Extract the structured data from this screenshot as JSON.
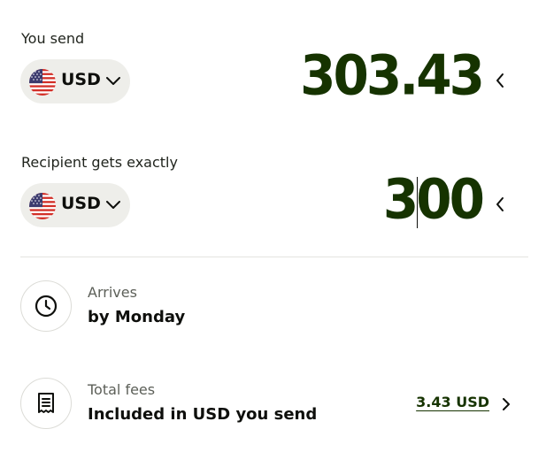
{
  "send": {
    "label": "You send",
    "currency": "USD",
    "currency_flag_icon": "us-flag-icon",
    "amount": "303.43"
  },
  "receive": {
    "label": "Recipient gets exactly",
    "currency": "USD",
    "currency_flag_icon": "us-flag-icon",
    "amount": "300"
  },
  "arrival": {
    "icon": "clock-icon",
    "label": "Arrives",
    "value": "by Monday"
  },
  "fees": {
    "icon": "receipt-icon",
    "label": "Total fees",
    "value": "Included in USD you send",
    "amount_link": "3.43 USD"
  },
  "colors": {
    "amount": "#163300",
    "pill_background": "#eeeeea",
    "divider": "#e3e3df"
  }
}
